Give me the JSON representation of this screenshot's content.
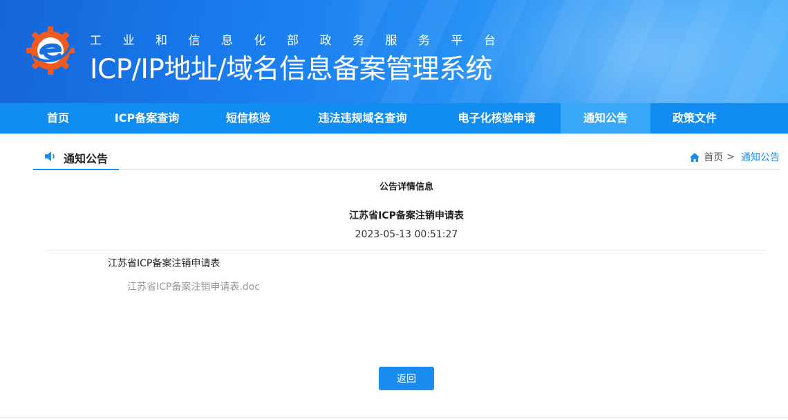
{
  "header": {
    "subtitle": "工业和信息化部政务服务平台",
    "title": "ICP/IP地址/域名信息备案管理系统",
    "logo_icon": "miit-gear-logo-icon",
    "colors": {
      "banner_start": "#1565d8",
      "banner_end": "#4bb0fb",
      "logo_orange": "#f05a1e"
    }
  },
  "nav": {
    "items": [
      {
        "label": "首页"
      },
      {
        "label": "ICP备案查询"
      },
      {
        "label": "短信核验"
      },
      {
        "label": "违法违规域名查询"
      },
      {
        "label": "电子化核验申请"
      },
      {
        "label": "通知公告"
      },
      {
        "label": "政策文件"
      }
    ],
    "active": "通知公告",
    "colors": {
      "bar": "#118cf0",
      "active": "#3aa8f8"
    }
  },
  "section": {
    "title": "通知公告",
    "icon": "speaker-icon",
    "breadcrumb": {
      "icon": "home-icon",
      "home": "首页",
      "separator": ">",
      "current": "通知公告"
    }
  },
  "content": {
    "heading": "公告详情信息",
    "notice_title": "江苏省ICP备案注销申请表",
    "date": "2023-05-13 00:51:27",
    "body": "江苏省ICP备案注销申请表",
    "attachment": "江苏省ICP备案注销申请表.doc"
  },
  "actions": {
    "back_label": "返回",
    "accent": "#1a8cf0"
  }
}
